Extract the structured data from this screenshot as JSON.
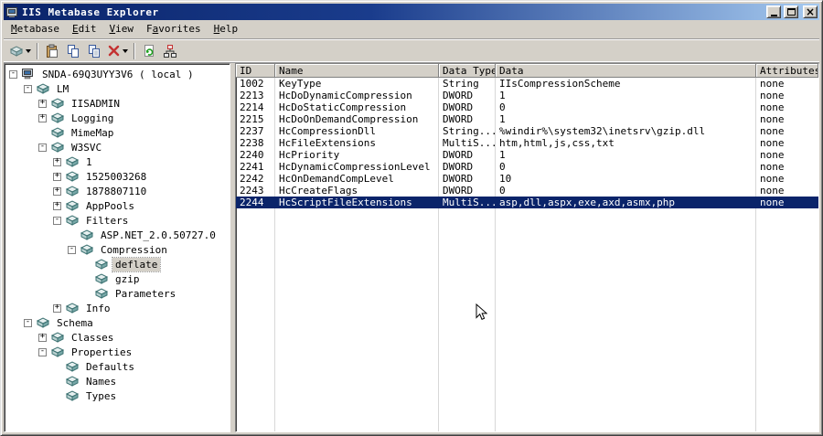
{
  "window": {
    "title": "IIS Metabase Explorer"
  },
  "colors": {
    "titlebar_gradient_start": "#0a246a",
    "titlebar_gradient_end": "#a6caf0",
    "chrome": "#d4d0c8",
    "selection": "#0a246a",
    "tree_inactive_selection": "#d4d0c8"
  },
  "menubar": {
    "items": [
      {
        "id": "metabase",
        "pre": "",
        "accel": "M",
        "post": "etabase"
      },
      {
        "id": "edit",
        "pre": "",
        "accel": "E",
        "post": "dit"
      },
      {
        "id": "view",
        "pre": "",
        "accel": "V",
        "post": "iew"
      },
      {
        "id": "favorites",
        "pre": "F",
        "accel": "a",
        "post": "vorites"
      },
      {
        "id": "help",
        "pre": "",
        "accel": "H",
        "post": "elp"
      }
    ]
  },
  "toolbar": {
    "icons": [
      "new-key-icon",
      "paste-icon",
      "copy-icon",
      "duplicate-icon",
      "delete-icon",
      "refresh-icon",
      "connect-computer-icon"
    ]
  },
  "tree": {
    "items": [
      {
        "id": "snda-69q3uyy3v6",
        "label": "SNDA-69Q3UYY3V6 ( local )",
        "depth": 0,
        "expand": "minus",
        "icon": "computer"
      },
      {
        "id": "lm",
        "label": "LM",
        "depth": 1,
        "expand": "minus",
        "icon": "key"
      },
      {
        "id": "iisadmin",
        "label": "IISADMIN",
        "depth": 2,
        "expand": "plus",
        "icon": "key"
      },
      {
        "id": "logging",
        "label": "Logging",
        "depth": 2,
        "expand": "plus",
        "icon": "key"
      },
      {
        "id": "mimemap",
        "label": "MimeMap",
        "depth": 2,
        "expand": "none",
        "icon": "key"
      },
      {
        "id": "w3svc",
        "label": "W3SVC",
        "depth": 2,
        "expand": "minus",
        "icon": "key"
      },
      {
        "id": "1",
        "label": "1",
        "depth": 3,
        "expand": "plus",
        "icon": "key"
      },
      {
        "id": "1525003268",
        "label": "1525003268",
        "depth": 3,
        "expand": "plus",
        "icon": "key"
      },
      {
        "id": "1878807110",
        "label": "1878807110",
        "depth": 3,
        "expand": "plus",
        "icon": "key"
      },
      {
        "id": "apppools",
        "label": "AppPools",
        "depth": 3,
        "expand": "plus",
        "icon": "key"
      },
      {
        "id": "filters",
        "label": "Filters",
        "depth": 3,
        "expand": "minus",
        "icon": "key"
      },
      {
        "id": "asp-net-2-0-50727-0",
        "label": "ASP.NET_2.0.50727.0",
        "depth": 4,
        "expand": "none",
        "icon": "key"
      },
      {
        "id": "compression",
        "label": "Compression",
        "depth": 4,
        "expand": "minus",
        "icon": "key"
      },
      {
        "id": "deflate",
        "label": "deflate",
        "depth": 5,
        "expand": "none",
        "icon": "key",
        "selected": true
      },
      {
        "id": "gzip",
        "label": "gzip",
        "depth": 5,
        "expand": "none",
        "icon": "key"
      },
      {
        "id": "parameters",
        "label": "Parameters",
        "depth": 5,
        "expand": "none",
        "icon": "key"
      },
      {
        "id": "info",
        "label": "Info",
        "depth": 3,
        "expand": "plus",
        "icon": "key"
      },
      {
        "id": "schema",
        "label": "Schema",
        "depth": 1,
        "expand": "minus",
        "icon": "key"
      },
      {
        "id": "classes",
        "label": "Classes",
        "depth": 2,
        "expand": "plus",
        "icon": "key"
      },
      {
        "id": "properties",
        "label": "Properties",
        "depth": 2,
        "expand": "minus",
        "icon": "key"
      },
      {
        "id": "defaults",
        "label": "Defaults",
        "depth": 3,
        "expand": "none",
        "icon": "key"
      },
      {
        "id": "names",
        "label": "Names",
        "depth": 3,
        "expand": "none",
        "icon": "key"
      },
      {
        "id": "types",
        "label": "Types",
        "depth": 3,
        "expand": "none",
        "icon": "key"
      }
    ]
  },
  "table": {
    "columns": [
      "ID",
      "Name",
      "Data Type",
      "Data",
      "Attributes"
    ],
    "rows": [
      {
        "id": "1002",
        "name": "KeyType",
        "type": "String",
        "data": "IIsCompressionScheme",
        "attrs": "none"
      },
      {
        "id": "2213",
        "name": "HcDoDynamicCompression",
        "type": "DWORD",
        "data": "1",
        "attrs": "none"
      },
      {
        "id": "2214",
        "name": "HcDoStaticCompression",
        "type": "DWORD",
        "data": "0",
        "attrs": "none"
      },
      {
        "id": "2215",
        "name": "HcDoOnDemandCompression",
        "type": "DWORD",
        "data": "1",
        "attrs": "none"
      },
      {
        "id": "2237",
        "name": "HcCompressionDll",
        "type": "String...",
        "data": "%windir%\\system32\\inetsrv\\gzip.dll",
        "attrs": "none"
      },
      {
        "id": "2238",
        "name": "HcFileExtensions",
        "type": "MultiS...",
        "data": "htm,html,js,css,txt",
        "attrs": "none"
      },
      {
        "id": "2240",
        "name": "HcPriority",
        "type": "DWORD",
        "data": "1",
        "attrs": "none"
      },
      {
        "id": "2241",
        "name": "HcDynamicCompressionLevel",
        "type": "DWORD",
        "data": "0",
        "attrs": "none"
      },
      {
        "id": "2242",
        "name": "HcOnDemandCompLevel",
        "type": "DWORD",
        "data": "10",
        "attrs": "none"
      },
      {
        "id": "2243",
        "name": "HcCreateFlags",
        "type": "DWORD",
        "data": "0",
        "attrs": "none"
      },
      {
        "id": "2244",
        "name": "HcScriptFileExtensions",
        "type": "MultiS...",
        "data": "asp,dll,aspx,exe,axd,asmx,php",
        "attrs": "none",
        "selected": true
      }
    ]
  }
}
